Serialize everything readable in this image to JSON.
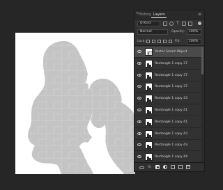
{
  "panel": {
    "close_glyph": "×",
    "menu_glyph": "≡",
    "tabs": [
      {
        "label": "History",
        "active": false
      },
      {
        "label": "Layers",
        "active": true
      }
    ],
    "filter": {
      "kind_label": "Q Kind"
    },
    "blend": {
      "mode": "Normal",
      "opacity_label": "Opacity:",
      "opacity_value": "100%"
    },
    "lock": {
      "label": "Lock:",
      "fill_label": "Fill:",
      "fill_value": "100%"
    },
    "layers": [
      {
        "name": "Vector Smart Object",
        "type": "smart",
        "selected": true
      },
      {
        "name": "Rectangle 1 copy 37",
        "type": "shape",
        "selected": false
      },
      {
        "name": "Rectangle 1 copy 37",
        "type": "shape",
        "selected": false
      },
      {
        "name": "Rectangle 1 copy 37",
        "type": "shape",
        "selected": false
      },
      {
        "name": "Rectangle 1 copy 43",
        "type": "shape",
        "selected": false
      },
      {
        "name": "Rectangle 1 copy 41",
        "type": "shape",
        "selected": false
      },
      {
        "name": "Rectangle 1 copy 41",
        "type": "shape",
        "selected": false
      },
      {
        "name": "Rectangle 1 copy 43",
        "type": "shape",
        "selected": false
      },
      {
        "name": "Rectangle 1 copy 43",
        "type": "shape",
        "selected": false
      },
      {
        "name": "Rectangle 1 copy 44",
        "type": "shape",
        "selected": false
      }
    ],
    "bottom_icons": [
      "link-icon",
      "fx-icon",
      "mask-icon",
      "adjustment-icon",
      "folder-icon",
      "new-layer-icon",
      "trash-icon"
    ],
    "bottom_fx_label": "fx"
  },
  "colors": {
    "workspace": "#262626",
    "panel": "#323232",
    "selected_layer": "#4a4a4a",
    "silhouette": "#c4c4c4",
    "tile_lines": "#d8d8d8"
  }
}
